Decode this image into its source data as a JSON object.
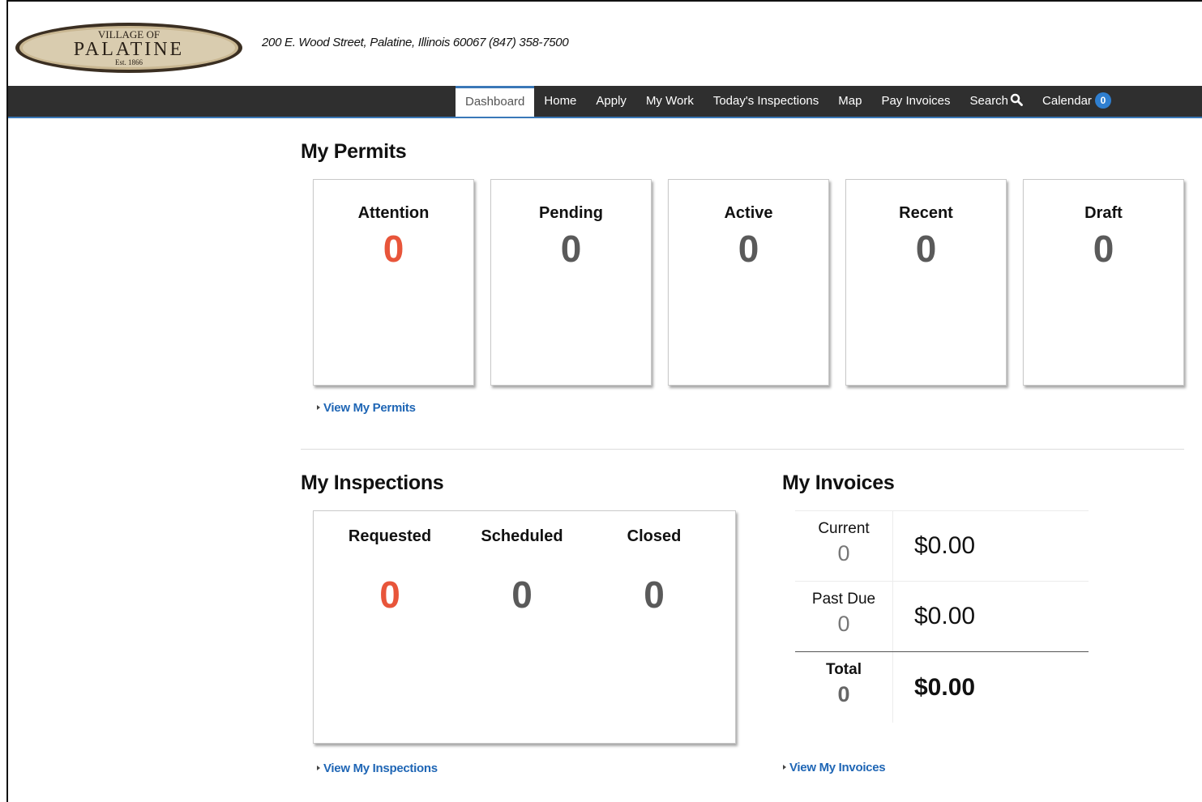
{
  "header": {
    "logo": {
      "line1": "VILLAGE OF",
      "line2": "PALATINE",
      "line3": "Est. 1866"
    },
    "address": "200 E. Wood Street, Palatine, Illinois 60067  (847) 358-7500"
  },
  "nav": {
    "dashboard": "Dashboard",
    "home": "Home",
    "apply": "Apply",
    "my_work": "My Work",
    "todays_inspections": "Today's Inspections",
    "map": "Map",
    "pay_invoices": "Pay Invoices",
    "search": "Search",
    "calendar": "Calendar",
    "calendar_badge": "0"
  },
  "permits": {
    "title": "My Permits",
    "cards": [
      {
        "label": "Attention",
        "count": "0"
      },
      {
        "label": "Pending",
        "count": "0"
      },
      {
        "label": "Active",
        "count": "0"
      },
      {
        "label": "Recent",
        "count": "0"
      },
      {
        "label": "Draft",
        "count": "0"
      }
    ],
    "view_link": "View My Permits"
  },
  "inspections": {
    "title": "My Inspections",
    "columns": [
      {
        "label": "Requested",
        "count": "0"
      },
      {
        "label": "Scheduled",
        "count": "0"
      },
      {
        "label": "Closed",
        "count": "0"
      }
    ],
    "view_link": "View My Inspections"
  },
  "invoices": {
    "title": "My Invoices",
    "rows": [
      {
        "label": "Current",
        "count": "0",
        "amount": "$0.00"
      },
      {
        "label": "Past Due",
        "count": "0",
        "amount": "$0.00"
      },
      {
        "label": "Total",
        "count": "0",
        "amount": "$0.00"
      }
    ],
    "view_link": "View My Invoices"
  },
  "colors": {
    "nav_bg": "#2f2f2f",
    "accent": "#3a78b8",
    "alert": "#e8553a",
    "link": "#1f66b5"
  }
}
